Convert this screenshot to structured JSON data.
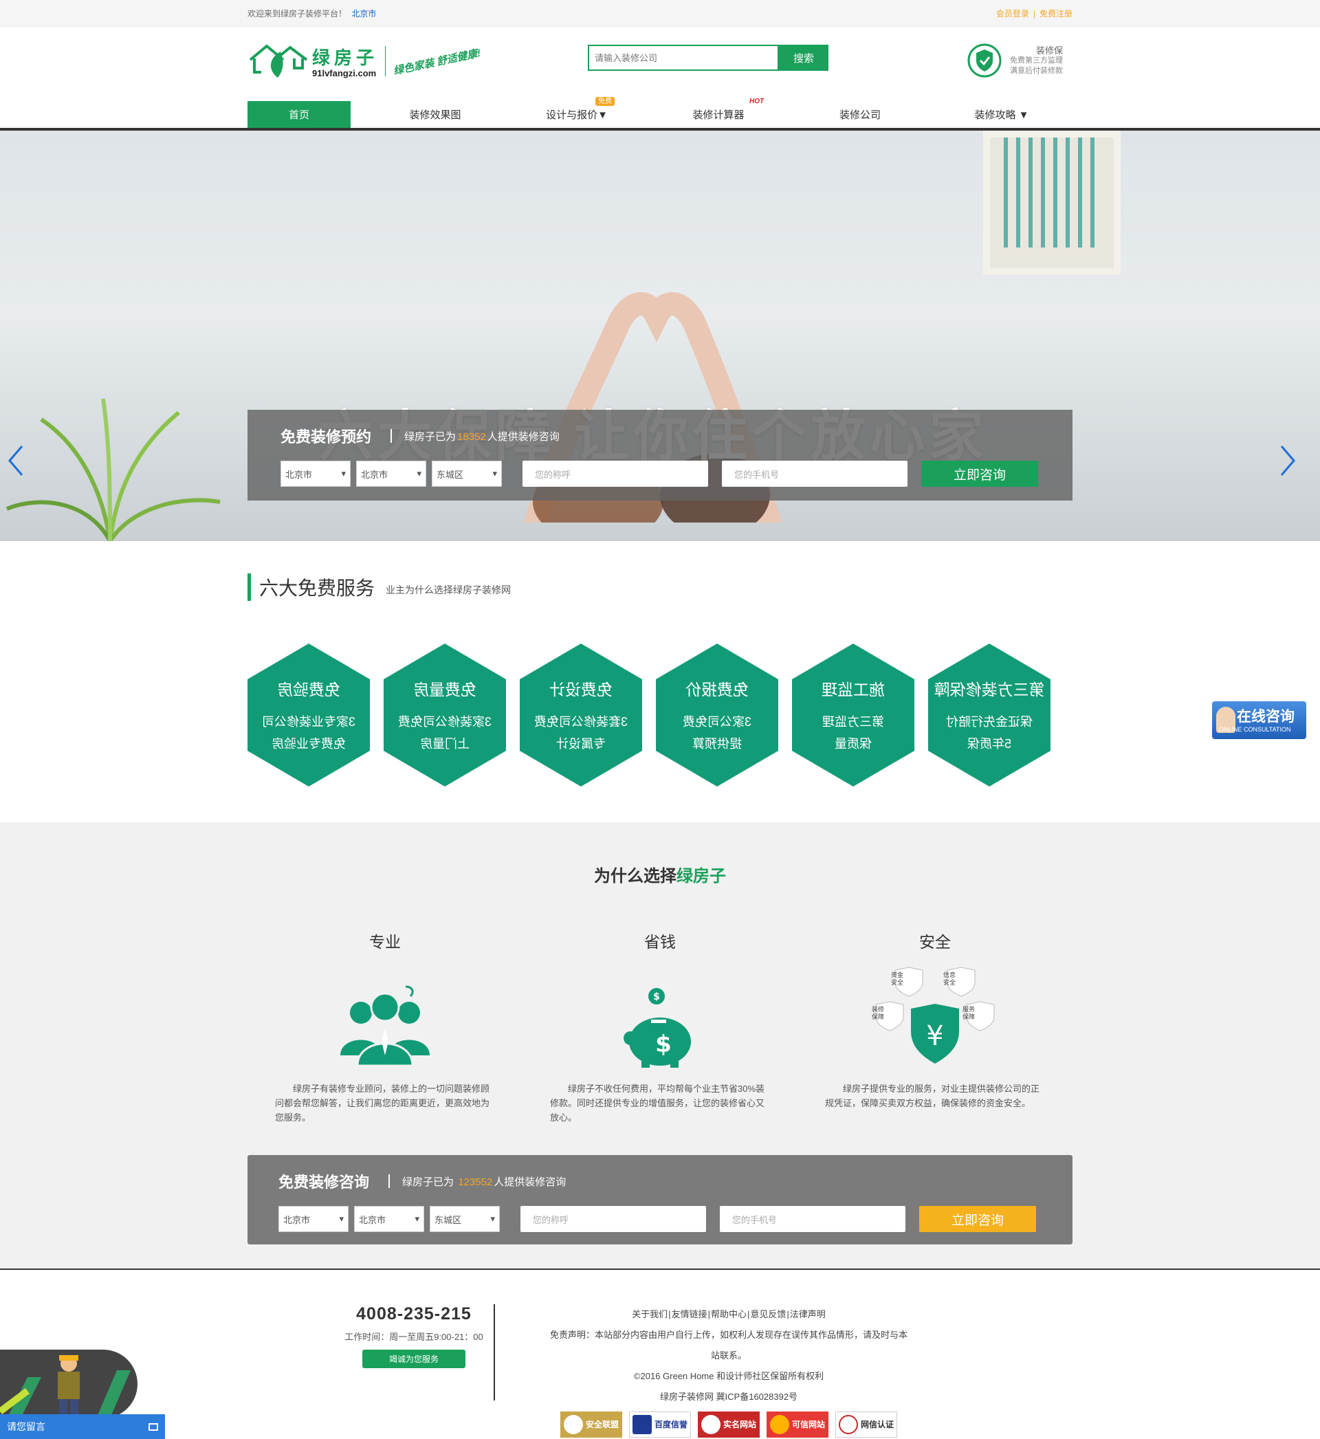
{
  "topbar": {
    "welcome": "欢迎来到绿房子装修平台！",
    "city": "北京市",
    "login": "会员登录",
    "register": "免费注册"
  },
  "logo": {
    "cn": "绿房子",
    "en": "91lvfangzi.com",
    "slogan": "绿色家装 舒适健康!"
  },
  "search": {
    "placeholder": "请输入装修公司",
    "button": "搜索"
  },
  "guard": {
    "title": "装修保",
    "line1": "免费第三方监理",
    "line2": "满意后付装修款"
  },
  "nav": {
    "items": [
      {
        "label": "首页"
      },
      {
        "label": "装修效果图"
      },
      {
        "label": "设计与报价▼",
        "badge": "免费"
      },
      {
        "label": "装修计算器",
        "hot": "HOT"
      },
      {
        "label": "装修公司"
      },
      {
        "label": "装修攻略 ▼"
      }
    ]
  },
  "banner": {
    "title": "六大保障  让你住个放心家",
    "book": {
      "title": "免费装修预约",
      "desc_pre": "绿房子已为",
      "count": "18352",
      "desc_post": "人提供装修咨询",
      "province": "北京市",
      "city": "北京市",
      "district": "东城区",
      "name_placeholder": "您的称呼",
      "phone_placeholder": "您的手机号",
      "submit": "立即咨询"
    },
    "dots": 5,
    "active_dot": 5
  },
  "services": {
    "title": "六大免费服务",
    "subtitle": "业主为什么选择绿房子装修网",
    "items": [
      {
        "title": "免费验房",
        "line1": "3家专业装修公司",
        "line2": "免费专业验房"
      },
      {
        "title": "免费量房",
        "line1": "3家装修公司免费",
        "line2": "上门量房"
      },
      {
        "title": "免费设计",
        "line1": "3套装修公司免费",
        "line2": "专属设计"
      },
      {
        "title": "免费报价",
        "line1": "3家公司免费",
        "line2": "提供预算"
      },
      {
        "title": "施工监理",
        "line1": "第三方监理",
        "line2": "保质量"
      },
      {
        "title": "第三方装修保障",
        "line1": "保证金先行赔付",
        "line2": "5年质保"
      }
    ]
  },
  "why": {
    "title_pre": "为什么选择",
    "title_brand": "绿房子",
    "cols": [
      {
        "head": "专业",
        "text": "绿房子有装修专业顾问，装修上的一切问题装修顾问都会帮您解答，让我们离您的距离更近，更高效地为您服务。"
      },
      {
        "head": "省钱",
        "text": "绿房子不收任何费用，平均帮每个业主节省30%装修款。同时还提供专业的增值服务，让您的装修省心又放心。"
      },
      {
        "head": "安全",
        "text": "绿房子提供专业的服务，对业主提供装修公司的正规凭证，保障买卖双方权益，确保装修的资金安全。"
      }
    ],
    "shields": {
      "a": "资金安全",
      "b": "信息安全",
      "c": "装修保障",
      "d": "服务保障",
      "center": "¥"
    }
  },
  "consult": {
    "title": "免费装修咨询",
    "desc_pre": "绿房子已为 ",
    "count": "123552",
    "desc_post": "人提供装修咨询",
    "province": "北京市",
    "city": "北京市",
    "district": "东城区",
    "name_placeholder": "您的称呼",
    "phone_placeholder": "您的手机号",
    "submit": "立即咨询"
  },
  "footer": {
    "phone": "4008-235-215",
    "hours": "工作时间：周一至周五9:00-21：00",
    "serve": "竭诚为您服务",
    "links": [
      "关于我们",
      "友情链接",
      "帮助中心",
      "意见反馈",
      "法律声明"
    ],
    "disclaimer": "免责声明：本站部分内容由用户自行上传，如权利人发现存在误传其作品情形，请及时与本站联系。",
    "copyright": "©2016 Green Home 和设计师社区保留所有权利",
    "icp": "绿房子装修网 冀ICP备16028392号",
    "badges": [
      "安全联盟",
      "百度信誉",
      "实名网站",
      "可信网站",
      "网信认证"
    ]
  },
  "float": {
    "online_cn": "在线咨询",
    "online_en": "ONLINE CONSULTATION",
    "message": "请您留言"
  },
  "colors": {
    "brand": "#1aa05a",
    "accent": "#f5a623",
    "link": "#1565c0"
  }
}
